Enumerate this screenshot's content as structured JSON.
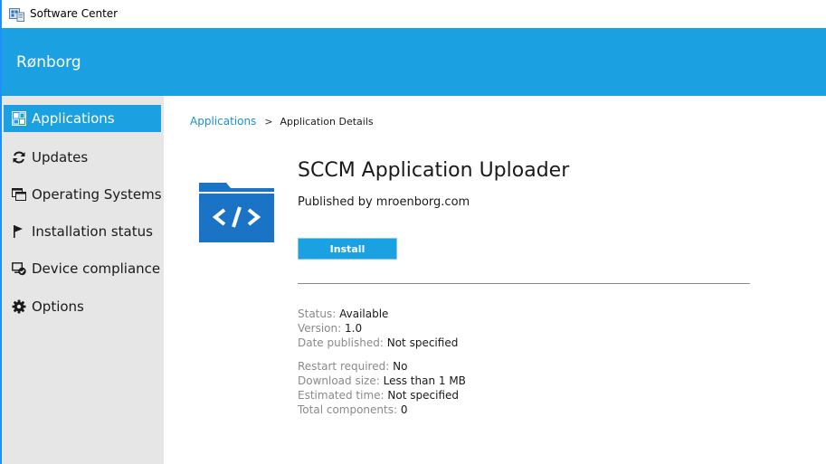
{
  "window": {
    "title": "Software Center",
    "app_icon": "software-center-icon"
  },
  "header": {
    "org_name": "Rønborg"
  },
  "colors": {
    "accent": "#1ba1e2",
    "sidebar_bg": "#e6e6e6",
    "link": "#1a8fd6",
    "muted_label": "#8a8a8a"
  },
  "sidebar": {
    "items": [
      {
        "label": "Applications",
        "icon": "applications-grid-icon",
        "active": true
      },
      {
        "label": "Updates",
        "icon": "refresh-icon",
        "active": false
      },
      {
        "label": "Operating Systems",
        "icon": "windows-stack-icon",
        "active": false
      },
      {
        "label": "Installation status",
        "icon": "flag-icon",
        "active": false
      },
      {
        "label": "Device compliance",
        "icon": "device-compliance-icon",
        "active": false
      },
      {
        "label": "Options",
        "icon": "gear-icon",
        "active": false
      }
    ]
  },
  "breadcrumb": {
    "parent": "Applications",
    "separator": ">",
    "current": "Application Details"
  },
  "app": {
    "logo_icon": "folder-code-icon",
    "title": "SCCM Application Uploader",
    "publisher": "Published by mroenborg.com",
    "install_label": "Install"
  },
  "details": {
    "group1": [
      {
        "key": "Status:",
        "value": "Available"
      },
      {
        "key": "Version:",
        "value": "1.0"
      },
      {
        "key": "Date published:",
        "value": "Not specified"
      }
    ],
    "group2": [
      {
        "key": "Restart required:",
        "value": "No"
      },
      {
        "key": "Download size:",
        "value": "Less than 1 MB"
      },
      {
        "key": "Estimated time:",
        "value": "Not specified"
      },
      {
        "key": "Total components:",
        "value": "0"
      }
    ]
  }
}
